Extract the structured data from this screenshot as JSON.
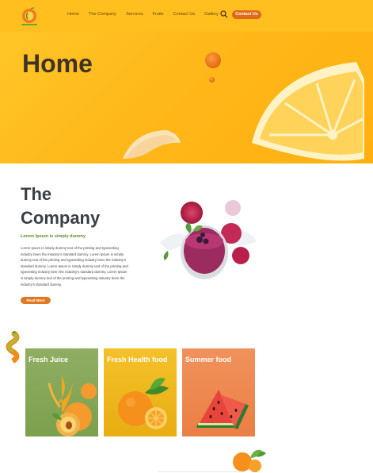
{
  "nav": {
    "items": [
      "Home",
      "The Company",
      "Services",
      "Fruits",
      "Contact Us",
      "Gallery"
    ],
    "contact_button": "Contact Us"
  },
  "hero": {
    "title": "Home"
  },
  "company": {
    "title_line1": "The",
    "title_line2": "Company",
    "subtitle": "Lorem Ipsum is simply dummy",
    "body": "Lorem Ipsum is simply dummy text of the printing and typesetting industry been the industry's standard dummy. Lorem Ipsum is simply dummy text of the printing and typesetting industry been the industry's standard dummy. Lorem Ipsum is simply dummy text of the printing and typesetting industry been the industry's standard dummy. Lorem Ipsum is simply dummy text of the printing and typesetting industry been the industry's standard dummy.",
    "read_more": "Read More"
  },
  "cards": [
    {
      "title": "Fresh Juice"
    },
    {
      "title": "Fresh Health food"
    },
    {
      "title": "Summer food"
    }
  ],
  "colors": {
    "hero_yellow": "#ffb81a",
    "accent_orange": "#e06a1a",
    "green_text": "#5c8a2c",
    "card_green": "#8fae62",
    "card_yellow": "#f4c12a",
    "card_orange": "#f0925c"
  },
  "icons": {
    "search": "search-icon",
    "logo": "fruit-logo-icon"
  }
}
